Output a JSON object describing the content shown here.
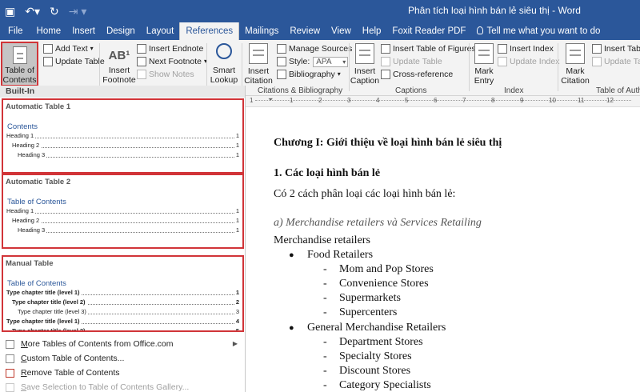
{
  "window": {
    "title": "Phân tích loại hình bán lẻ siêu thị  -  Word"
  },
  "qat": {
    "save_icon": "save-icon",
    "undo_icon": "undo-icon",
    "redo_icon": "redo-icon",
    "customize_icon": "customize-qat-icon"
  },
  "tabs": [
    {
      "label": "File"
    },
    {
      "label": "Home"
    },
    {
      "label": "Insert"
    },
    {
      "label": "Design"
    },
    {
      "label": "Layout"
    },
    {
      "label": "References"
    },
    {
      "label": "Mailings"
    },
    {
      "label": "Review"
    },
    {
      "label": "View"
    },
    {
      "label": "Help"
    },
    {
      "label": "Foxit Reader PDF"
    },
    {
      "label": "Tell me what you want to do"
    }
  ],
  "ribbon": {
    "toc": {
      "button": "Table of\nContents",
      "add_text": "Add Text",
      "update_table": "Update Table"
    },
    "footnotes": {
      "insert_footnote": "Insert\nFootnote",
      "insert_endnote": "Insert Endnote",
      "next_footnote": "Next Footnote",
      "show_notes": "Show Notes",
      "ab_label": "AB¹"
    },
    "research": {
      "smart_lookup": "Smart\nLookup"
    },
    "citations": {
      "insert_citation": "Insert\nCitation",
      "manage_sources": "Manage Sources",
      "style_label": "Style:",
      "style_value": "APA",
      "bibliography": "Bibliography",
      "group_label": "Citations & Bibliography"
    },
    "captions": {
      "insert_caption": "Insert\nCaption",
      "insert_table_of_figures": "Insert Table of Figures",
      "update_table": "Update Table",
      "cross_reference": "Cross-reference",
      "group_label": "Captions"
    },
    "index": {
      "mark_entry": "Mark\nEntry",
      "insert_index": "Insert Index",
      "update_index": "Update Index",
      "group_label": "Index"
    },
    "authorities": {
      "mark_citation": "Mark\nCitation",
      "insert_table": "Insert Table",
      "update_table": "Update Table",
      "group_label": "Table of Authori"
    }
  },
  "panel": {
    "section_label": "Built-In",
    "gallery": [
      {
        "title": "Automatic Table 1",
        "heading": "Contents",
        "lines": [
          {
            "text": "Heading 1",
            "num": "1",
            "level": 1
          },
          {
            "text": "Heading 2",
            "num": "1",
            "level": 2
          },
          {
            "text": "Heading 3",
            "num": "1",
            "level": 3
          }
        ]
      },
      {
        "title": "Automatic Table 2",
        "heading": "Table of Contents",
        "lines": [
          {
            "text": "Heading 1",
            "num": "1",
            "level": 1
          },
          {
            "text": "Heading 2",
            "num": "1",
            "level": 2
          },
          {
            "text": "Heading 3",
            "num": "1",
            "level": 3
          }
        ]
      },
      {
        "title": "Manual Table",
        "heading": "Table of Contents",
        "lines": [
          {
            "text": "Type chapter title (level 1)",
            "num": "1",
            "level": 1
          },
          {
            "text": "Type chapter title (level 2)",
            "num": "2",
            "level": 2
          },
          {
            "text": "Type chapter title (level 3)",
            "num": "3",
            "level": 3
          },
          {
            "text": "Type chapter title (level 1)",
            "num": "4",
            "level": 1
          },
          {
            "text": "Type chapter title (level 2)",
            "num": "5",
            "level": 2
          }
        ]
      }
    ],
    "menu": [
      {
        "label": "More Tables of Contents from Office.com",
        "u": "M",
        "rest": "ore Tables of Contents from Office.com",
        "submenu": true,
        "disabled": false
      },
      {
        "label": "Custom Table of Contents...",
        "u": "C",
        "rest": "ustom Table of Contents...",
        "submenu": false,
        "disabled": false
      },
      {
        "label": "Remove Table of Contents",
        "u": "R",
        "rest": "emove Table of Contents",
        "submenu": false,
        "disabled": false
      },
      {
        "label": "Save Selection to Table of Contents Gallery...",
        "u": "S",
        "rest": "ave Selection to Table of Contents Gallery...",
        "submenu": false,
        "disabled": true
      }
    ]
  },
  "ruler": {
    "numbers": [
      "1",
      "2",
      "3",
      "4",
      "5",
      "6",
      "7",
      "8",
      "9",
      "10",
      "11",
      "12",
      "13"
    ]
  },
  "document": {
    "chapter_title": "Chương I: Giới thiệu về loại hình bán lẻ siêu thị",
    "section_title": "1. Các loại hình bán lẻ",
    "intro": "Có 2 cách phân loại các loại hình bán lẻ:",
    "subsection": "a) Merchandise retailers và Services Retailing",
    "category": "Merchandise retailers",
    "bullet1": "Food Retailers",
    "food_items": [
      "Mom and Pop Stores",
      "Convenience Stores",
      "Supermarkets",
      "Supercenters"
    ],
    "bullet2": "General Merchandise Retailers",
    "general_items": [
      "Department Stores",
      "Specialty Stores",
      "Discount Stores",
      "Category Specialists"
    ]
  },
  "colors": {
    "accent": "#2b579a",
    "highlight": "#d13438"
  }
}
